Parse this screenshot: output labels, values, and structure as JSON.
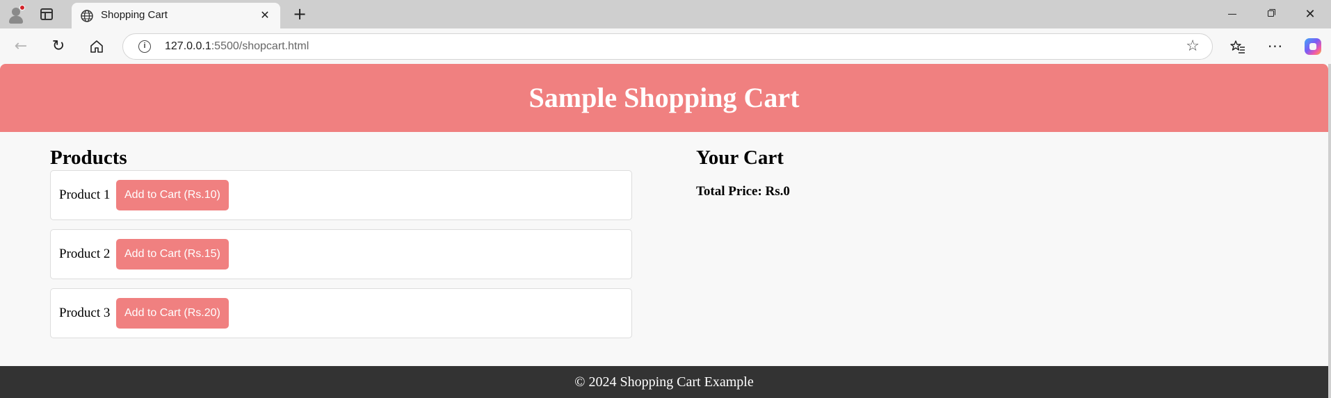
{
  "browser": {
    "tab_title": "Shopping Cart",
    "tab_close": "✕",
    "new_tab": "+",
    "url_host": "127.0.0.1",
    "url_rest": ":5500/shopcart.html",
    "window_controls": {
      "close": "✕"
    }
  },
  "header": {
    "title": "Sample Shopping Cart"
  },
  "products": {
    "heading": "Products",
    "items": [
      {
        "name": "Product 1",
        "button": "Add to Cart (Rs.10)"
      },
      {
        "name": "Product 2",
        "button": "Add to Cart (Rs.15)"
      },
      {
        "name": "Product 3",
        "button": "Add to Cart (Rs.20)"
      }
    ]
  },
  "cart": {
    "heading": "Your Cart",
    "total": "Total Price: Rs.0"
  },
  "footer": {
    "text": "© 2024 Shopping Cart Example"
  },
  "colors": {
    "accent": "#f08080",
    "footer_bg": "#333333",
    "page_bg": "#f8f8f8"
  }
}
